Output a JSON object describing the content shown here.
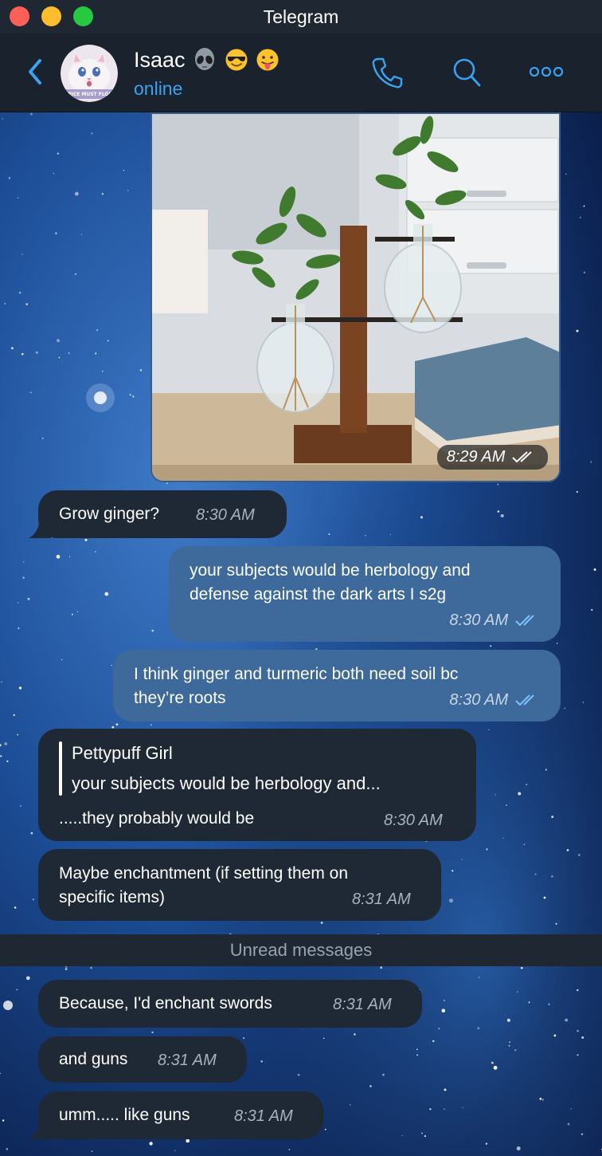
{
  "window": {
    "title": "Telegram"
  },
  "header": {
    "contact_name": "Isaac",
    "status": "online",
    "avatar_caption": "SPICE MUST FLOW",
    "emojis": [
      "alien-face",
      "smiling-face-with-sunglasses",
      "face-with-tongue"
    ]
  },
  "colors": {
    "accent": "#3aa3f0",
    "incoming_bubble": "#1f2936",
    "outgoing_bubble": "#3d6a9a",
    "header_bg": "#1a222e"
  },
  "messages": [
    {
      "id": "m0",
      "direction": "out",
      "type": "photo",
      "time": "8:29 AM",
      "read": true
    },
    {
      "id": "m1",
      "direction": "in",
      "text": "Grow ginger?",
      "time": "8:30 AM"
    },
    {
      "id": "m2",
      "direction": "out",
      "text_lines": [
        "your subjects would be herbology and",
        "defense against the dark arts I s2g"
      ],
      "time": "8:30 AM",
      "read": true
    },
    {
      "id": "m3",
      "direction": "out",
      "text_lines": [
        "I think ginger and turmeric both need soil bc",
        "they’re roots"
      ],
      "time": "8:30 AM",
      "read": true
    },
    {
      "id": "m4",
      "direction": "in",
      "reply_author": "Pettypuff Girl",
      "reply_text": "your subjects would be herbology and...",
      "text": ".....they probably would be",
      "time": "8:30 AM"
    },
    {
      "id": "m5",
      "direction": "in",
      "text_lines": [
        "Maybe enchantment (if setting them on",
        "specific items)"
      ],
      "time": "8:31 AM"
    },
    {
      "id": "m6",
      "direction": "in",
      "text": "Because, I'd enchant swords",
      "time": "8:31 AM"
    },
    {
      "id": "m7",
      "direction": "in",
      "text": "and guns",
      "time": "8:31 AM"
    },
    {
      "id": "m8",
      "direction": "in",
      "text": "umm..... like guns",
      "time": "8:31 AM"
    }
  ],
  "unread_divider": "Unread messages"
}
